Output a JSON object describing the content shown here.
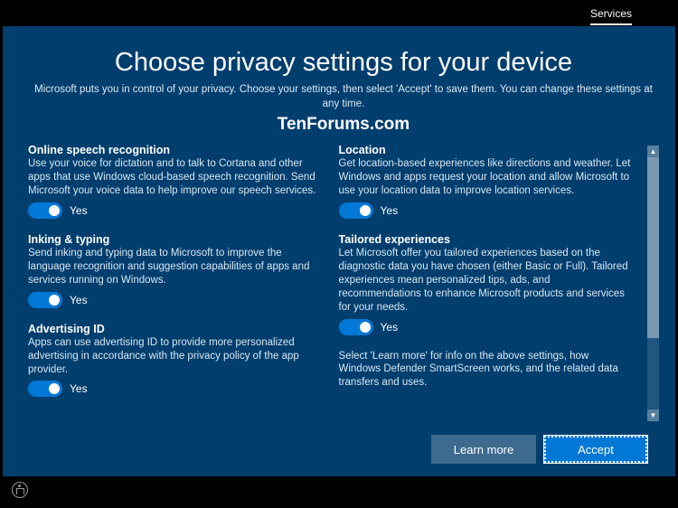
{
  "header": {
    "tab": "Services"
  },
  "title": "Choose privacy settings for your device",
  "subtitle": "Microsoft puts you in control of your privacy. Choose your settings, then select 'Accept' to save them. You can change these settings at any time.",
  "watermark": "TenForums.com",
  "left": [
    {
      "title": "Online speech recognition",
      "desc": "Use your voice for dictation and to talk to Cortana and other apps that use Windows cloud-based speech recognition. Send Microsoft your voice data to help improve our speech services.",
      "state": "Yes"
    },
    {
      "title": "Inking & typing",
      "desc": "Send inking and typing data to Microsoft to improve the language recognition and suggestion capabilities of apps and services running on Windows.",
      "state": "Yes"
    },
    {
      "title": "Advertising ID",
      "desc": "Apps can use advertising ID to provide more personalized advertising in accordance with the privacy policy of the app provider.",
      "state": "Yes"
    }
  ],
  "right": [
    {
      "title": "Location",
      "desc": "Get location-based experiences like directions and weather. Let Windows and apps request your location and allow Microsoft to use your location data to improve location services.",
      "state": "Yes"
    },
    {
      "title": "Tailored experiences",
      "desc": "Let Microsoft offer you tailored experiences based on the diagnostic data you have chosen (either Basic or Full). Tailored experiences mean personalized tips, ads, and recommendations to enhance Microsoft products and services for your needs.",
      "state": "Yes"
    }
  ],
  "info": "Select 'Learn more' for info on the above settings, how Windows Defender SmartScreen works, and the related data transfers and uses.",
  "buttons": {
    "learn": "Learn more",
    "accept": "Accept"
  }
}
